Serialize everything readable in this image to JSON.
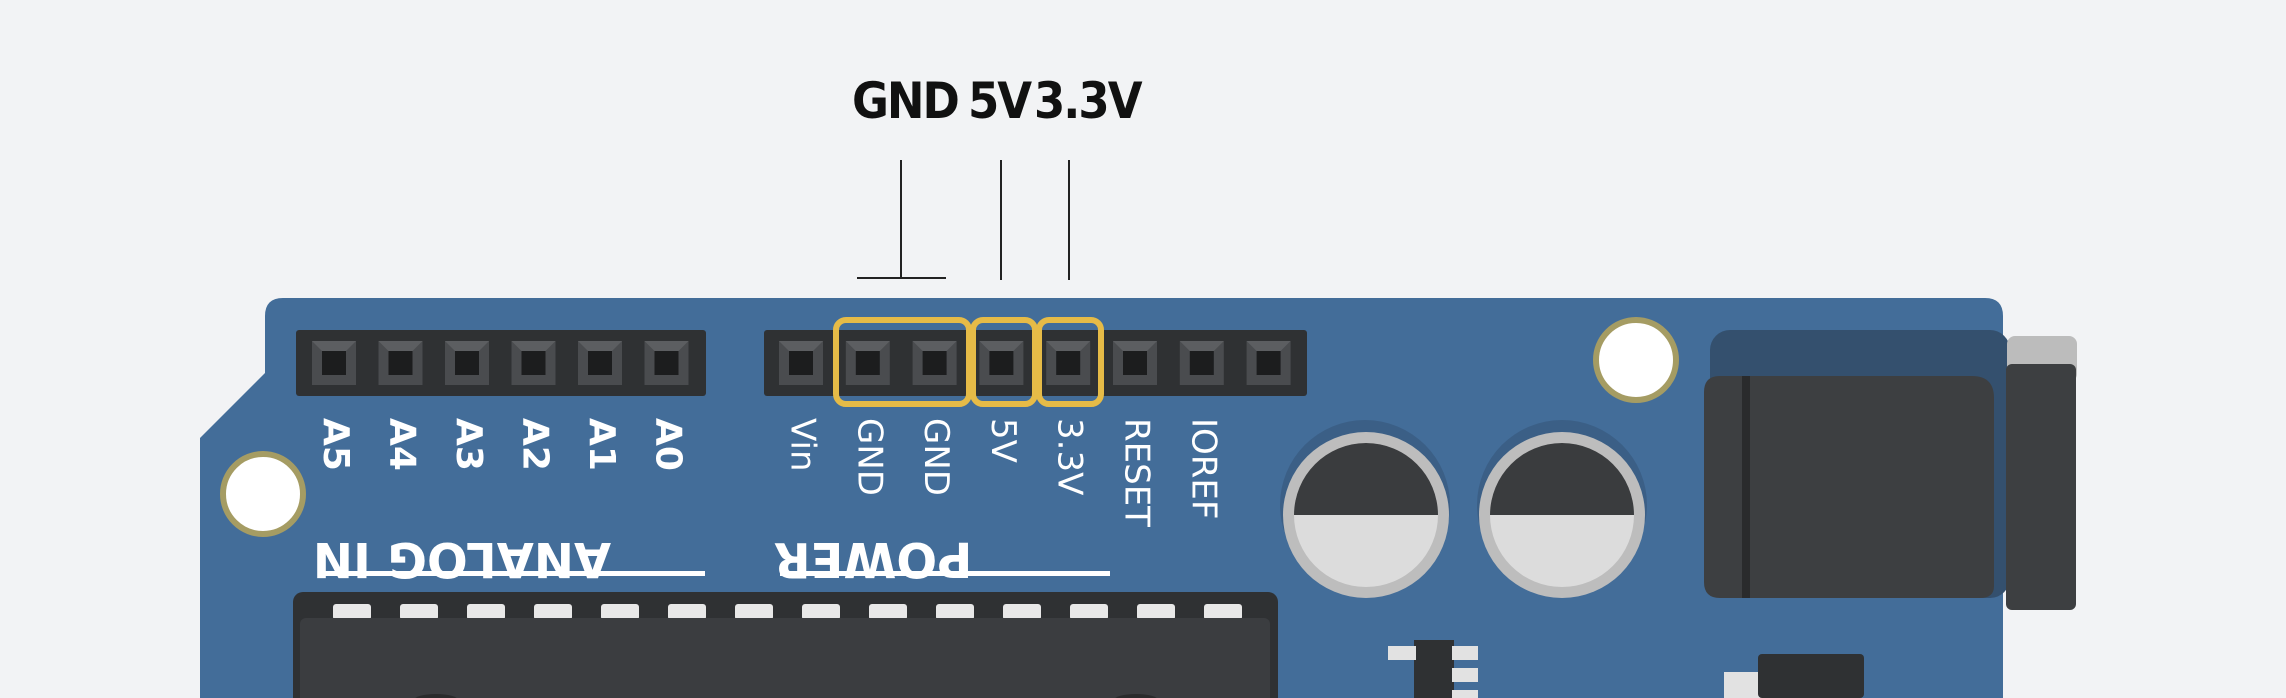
{
  "callouts": {
    "gnd": "GND",
    "v5": "5V",
    "v33": "3.3V"
  },
  "board": {
    "analog_header": {
      "title": "ANALOG IN",
      "pins": [
        "A5",
        "A4",
        "A3",
        "A2",
        "A1",
        "A0"
      ]
    },
    "power_header": {
      "title": "POWER",
      "pins": [
        "Vin",
        "GND",
        "GND",
        "5V",
        "3.3V",
        "RESET",
        "IOREF"
      ]
    }
  },
  "colors": {
    "board": "#436d99",
    "highlight": "#e6bb47",
    "header": "#2f3133",
    "background": "#f2f3f5"
  }
}
